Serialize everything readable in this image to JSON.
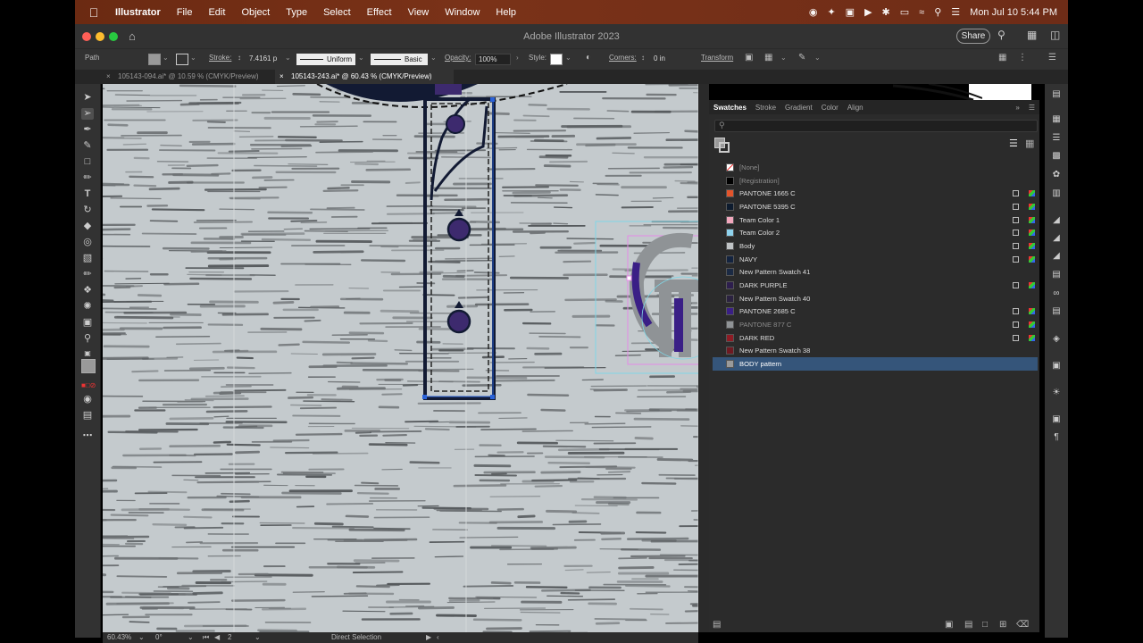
{
  "menubar": {
    "apple": "",
    "app_name": "Illustrator",
    "menus": [
      "File",
      "Edit",
      "Object",
      "Type",
      "Select",
      "Effect",
      "View",
      "Window",
      "Help"
    ],
    "clock": "Mon Jul 10  5:44 PM"
  },
  "window": {
    "title": "Adobe Illustrator 2023",
    "share_label": "Share"
  },
  "control_bar": {
    "selection_type": "Path",
    "stroke_label": "Stroke:",
    "stroke_value": "7.4161 p",
    "profile": "Uniform",
    "brush": "Basic",
    "opacity_label": "Opacity:",
    "opacity_value": "100%",
    "style_label": "Style:",
    "corners_label": "Corners:",
    "corners_value": "0 in",
    "transform_label": "Transform"
  },
  "doc_tabs": [
    {
      "label": "105143-094.ai* @ 10.59 % (CMYK/Preview)",
      "active": false
    },
    {
      "label": "105143-243.ai* @ 60.43 % (CMYK/Preview)",
      "active": true
    }
  ],
  "panel": {
    "tabs": [
      "Swatches",
      "Stroke",
      "Gradient",
      "Color",
      "Align"
    ],
    "active_tab": "Swatches",
    "swatches": [
      {
        "name": "[None]",
        "color": "none",
        "dim": true,
        "process": false
      },
      {
        "name": "[Registration]",
        "color": "#000000",
        "dim": true,
        "process": false
      },
      {
        "name": "PANTONE 1665 C",
        "color": "#e4542b",
        "dim": false,
        "process": true
      },
      {
        "name": "PANTONE 5395 C",
        "color": "#0d1b2e",
        "dim": false,
        "process": true
      },
      {
        "name": "Team Color 1",
        "color": "#f2a7bd",
        "dim": false,
        "process": true
      },
      {
        "name": "Team Color 2",
        "color": "#8fd3ee",
        "dim": false,
        "process": true
      },
      {
        "name": "Body",
        "color": "#bfc3c5",
        "dim": false,
        "process": true
      },
      {
        "name": "NAVY",
        "color": "#13233f",
        "dim": false,
        "process": true
      },
      {
        "name": "New Pattern Swatch 41",
        "color": "#1b2a44",
        "dim": false,
        "process": false
      },
      {
        "name": "DARK PURPLE",
        "color": "#2d1e4d",
        "dim": false,
        "process": true
      },
      {
        "name": "New Pattern Swatch 40",
        "color": "#2b2240",
        "dim": false,
        "process": false
      },
      {
        "name": "PANTONE 2685 C",
        "color": "#3a1f86",
        "dim": false,
        "process": true
      },
      {
        "name": "PANTONE 877 C",
        "color": "#8f9396",
        "dim": true,
        "process": true
      },
      {
        "name": "DARK RED",
        "color": "#8e1b24",
        "dim": false,
        "process": true
      },
      {
        "name": "New Pattern Swatch 38",
        "color": "#6e1a22",
        "dim": false,
        "process": false
      },
      {
        "name": "BODY pattern",
        "color": "#9a9a9a",
        "dim": false,
        "process": false,
        "selected": true
      }
    ]
  },
  "status_bar": {
    "zoom": "60.43%",
    "rotation": "0°",
    "artboard": "2",
    "tool": "Direct Selection"
  },
  "colors": {
    "canvas_bg": "#c4cacd",
    "stripe": "#6e7275",
    "navy": "#121a33",
    "purple": "#3d2a6e",
    "selection_blue": "#2a62d9"
  }
}
